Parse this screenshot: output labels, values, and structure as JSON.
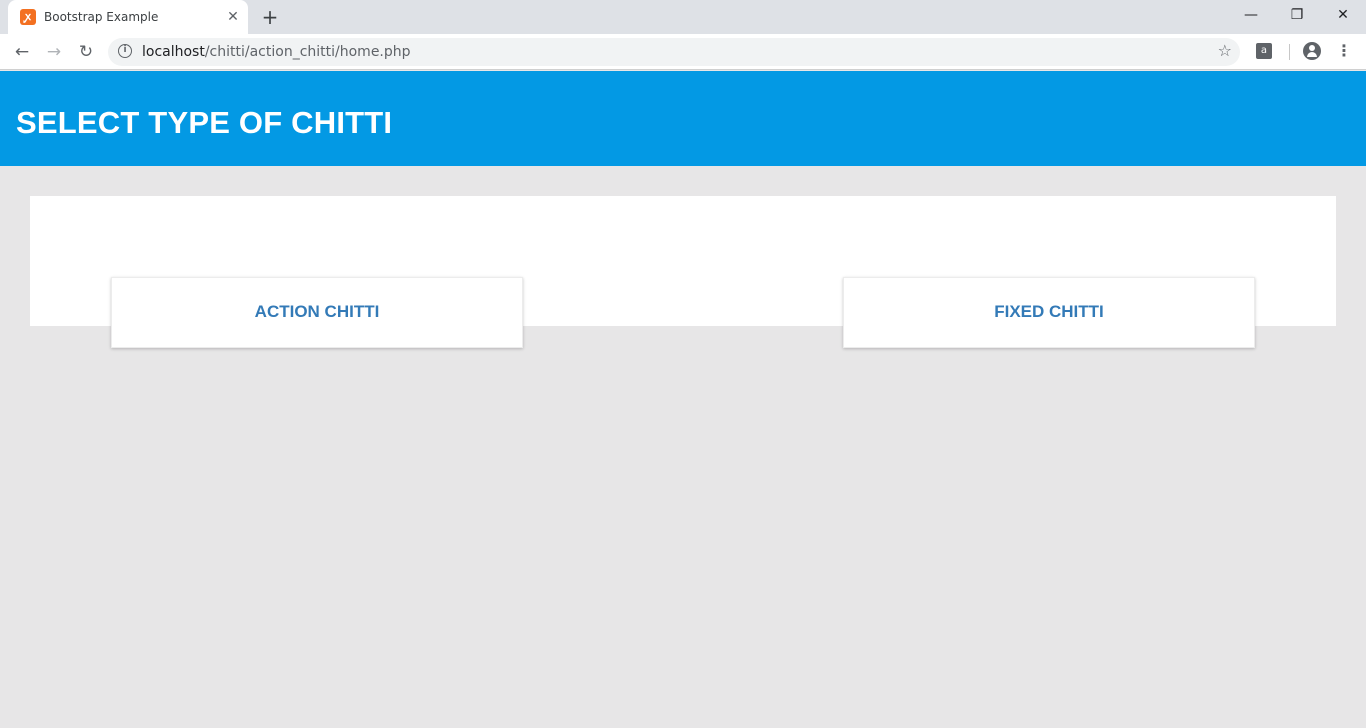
{
  "browser": {
    "tab_title": "Bootstrap Example",
    "tab_close": "✕",
    "new_tab": "+",
    "url_host": "localhost",
    "url_path": "/chitti/action_chitti/home.php",
    "window_controls": {
      "minimize": "—",
      "maximize": "❐",
      "close": "✕"
    },
    "icons": [
      "xampp-favicon",
      "back-icon",
      "forward-icon",
      "reload-icon",
      "info-icon",
      "star-icon",
      "extension-icon",
      "profile-icon",
      "menu-icon"
    ]
  },
  "header": {
    "title": "SELECT TYPE OF CHITTI",
    "background": "#0399e4"
  },
  "options": [
    {
      "label": "ACTION CHITTI",
      "color": "#337ab7"
    },
    {
      "label": "FIXED CHITTI",
      "color": "#337ab7"
    }
  ]
}
